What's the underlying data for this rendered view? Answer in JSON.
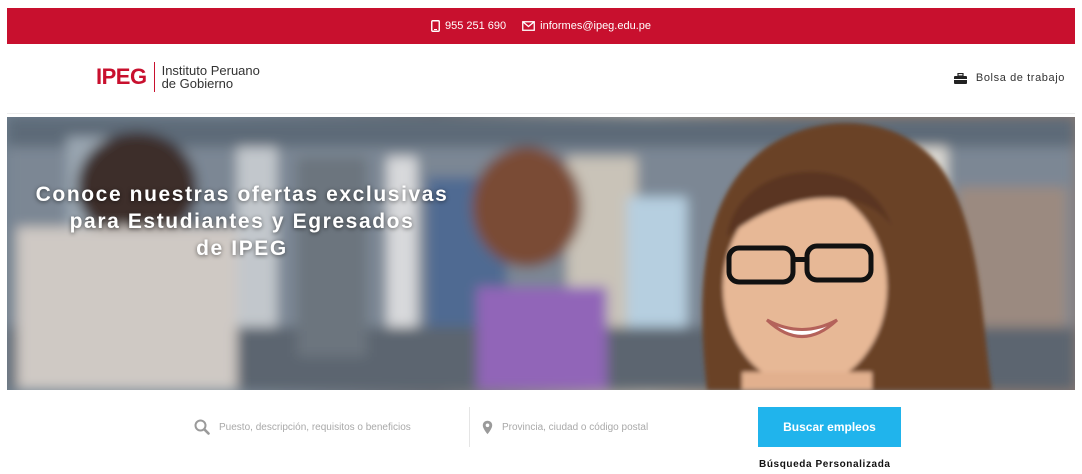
{
  "topbar": {
    "phone": "955 251 690",
    "email": "informes@ipeg.edu.pe",
    "background": "#c8102e"
  },
  "header": {
    "logo_mark": "IPEG",
    "logo_line1": "Instituto Peruano",
    "logo_line2": "de Gobierno",
    "jobs_link": "Bolsa de trabajo",
    "jobs_icon": "briefcase-icon"
  },
  "hero": {
    "title_line1": "Conoce nuestras ofertas exclusivas",
    "title_line2": "para Estudiantes y Egresados",
    "title_line3": "de IPEG"
  },
  "search": {
    "keyword_placeholder": "Puesto, descripción, requisitos o beneficios",
    "location_placeholder": "Provincia, ciudad o código postal",
    "button_label": "Buscar empleos",
    "button_color": "#20b4ec",
    "custom_search_link": "Búsqueda Personalizada",
    "keyword_icon": "search-icon",
    "location_icon": "map-pin-icon"
  }
}
